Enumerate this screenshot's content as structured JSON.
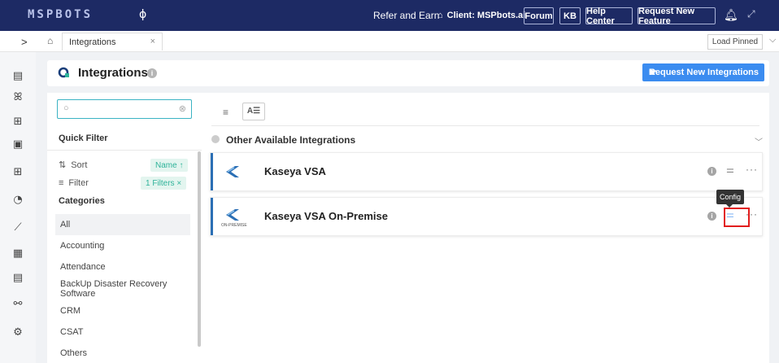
{
  "topbar": {
    "logo": "MSPBOTS",
    "refer": "Refer and Earn",
    "client": "Client: MSPbots.ai",
    "buttons": [
      {
        "label": "Forum"
      },
      {
        "label": "KB"
      },
      {
        "label": "Help Center"
      },
      {
        "label": "Request New Feature"
      }
    ]
  },
  "tabs": {
    "active": "Integrations",
    "load_pinned": "Load Pinned"
  },
  "header": {
    "title": "Integrations",
    "request_button": "Request New Integrations"
  },
  "left": {
    "search": {
      "placeholder": "",
      "value": ""
    },
    "quick_filter": "Quick Filter",
    "sort_label": "Sort",
    "sort_value": "Name ↑",
    "filter_label": "Filter",
    "filter_value": "1 Filters ×",
    "categories_title": "Categories",
    "categories": [
      "All",
      "Accounting",
      "Attendance",
      "BackUp Disaster Recovery Software",
      "CRM",
      "CSAT",
      "Others"
    ],
    "active_category": "All"
  },
  "main": {
    "view_toggle": "A☰",
    "section_title": "Other Available Integrations",
    "integrations": [
      {
        "name": "Kaseya VSA",
        "logo_sub": ""
      },
      {
        "name": "Kaseya VSA On-Premise",
        "logo_sub": "ON-PREMISE"
      }
    ],
    "tooltip": "Config"
  },
  "colors": {
    "topbar": "#1d2a64",
    "accent": "#3b8cf0",
    "teal": "#2fb39a",
    "highlight": "#e21d1d"
  },
  "icons": [
    "logo-icon",
    "home-icon",
    "bell-icon",
    "expand-icon",
    "chevron-right-icon",
    "info-icon",
    "search-icon",
    "clear-icon",
    "sort-icon",
    "filter-icon",
    "list-view-icon",
    "config-icon",
    "more-icon",
    "chevron-down-icon"
  ]
}
